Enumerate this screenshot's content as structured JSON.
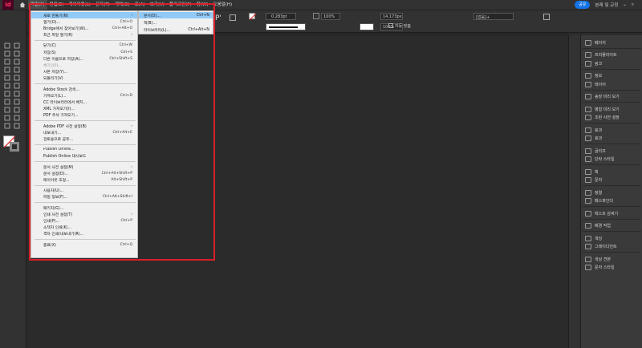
{
  "app": {
    "logo": "Id"
  },
  "menubar": {
    "items": [
      {
        "label": "파일(F)",
        "active": true
      },
      {
        "label": "편집(E)"
      },
      {
        "label": "레이아웃(L)"
      },
      {
        "label": "문자(T)"
      },
      {
        "label": "개체(O)"
      },
      {
        "label": "표(A)"
      },
      {
        "label": "보기(V)"
      },
      {
        "label": "플러그인(P)"
      },
      {
        "label": "창(W)"
      },
      {
        "label": "도움말(H)"
      }
    ],
    "share_label": "공유",
    "workspace_label": "본래 및 교정"
  },
  "controlbar": {
    "stroke_weight": "0.283pt",
    "percent_1": "100%",
    "width_value": "14.173px",
    "percent_2": "100%",
    "auto_fit_label": "자동 맞춤",
    "style_select": "[없음]+"
  },
  "file_menu": {
    "items": [
      {
        "label": "새로 만들기(N)",
        "shortcut": "",
        "arrow": true,
        "highlight": true
      },
      {
        "label": "열기(O)...",
        "shortcut": "Ctrl+O"
      },
      {
        "label": "Bridge에서 찾아보기(W)...",
        "shortcut": "Ctrl+Alt+O"
      },
      {
        "label": "최근 파일 열기(R)",
        "shortcut": "",
        "arrow": true
      },
      {
        "sep": true
      },
      {
        "label": "닫기(C)",
        "shortcut": "Ctrl+W"
      },
      {
        "label": "저장(S)",
        "shortcut": "Ctrl+S"
      },
      {
        "label": "다른 이름으로 저장(A)...",
        "shortcut": "Ctrl+Shift+S"
      },
      {
        "label": "체크인(I)...",
        "disabled": true
      },
      {
        "label": "사본 저장(Y)..."
      },
      {
        "label": "되돌리기(V)"
      },
      {
        "sep": true
      },
      {
        "label": "Adobe Stock 검색..."
      },
      {
        "label": "가져오기(L)...",
        "shortcut": "Ctrl+D"
      },
      {
        "label": "CC 라이브러리에서 배치..."
      },
      {
        "label": "XML 가져오기(I)..."
      },
      {
        "label": "PDF 주석 가져오기..."
      },
      {
        "sep": true
      },
      {
        "label": "Adobe PDF 사전 설정(B)",
        "arrow": true
      },
      {
        "label": "내보내기...",
        "shortcut": "Ctrl+Alt+E"
      },
      {
        "label": "검토용으로 공유..."
      },
      {
        "sep": true
      },
      {
        "label": "Publish Online..."
      },
      {
        "label": "Publish Online 대시보드"
      },
      {
        "sep": true
      },
      {
        "label": "문서 사전 설정(M)",
        "arrow": true
      },
      {
        "label": "문서 설정(D)...",
        "shortcut": "Ctrl+Alt+Shift+P"
      },
      {
        "label": "레이아웃 조정...",
        "shortcut": "Alt+Shift+P"
      },
      {
        "sep": true
      },
      {
        "label": "사용자(U)..."
      },
      {
        "label": "파일 정보(F)...",
        "shortcut": "Ctrl+Alt+Shift+I"
      },
      {
        "sep": true
      },
      {
        "label": "패키지(G)..."
      },
      {
        "label": "인쇄 사전 설정(T)",
        "arrow": true
      },
      {
        "label": "인쇄(P)...",
        "shortcut": "Ctrl+P"
      },
      {
        "label": "소책자 인쇄(K)..."
      },
      {
        "label": "격자 인쇄/내보내기(R)..."
      },
      {
        "sep": true
      },
      {
        "label": "종료(X)",
        "shortcut": "Ctrl+Q"
      }
    ]
  },
  "new_submenu": {
    "items": [
      {
        "label": "문서(D)...",
        "shortcut": "Ctrl+N",
        "highlight": true
      },
      {
        "label": "책(B)..."
      },
      {
        "label": "라이브러리(L)...",
        "shortcut": "Ctrl+Alt+N"
      }
    ]
  },
  "right_panel": {
    "items": [
      {
        "label": "페이지",
        "icon": "pages-icon"
      },
      {
        "sep": true
      },
      {
        "label": "프리플라이트",
        "icon": "preflight-icon"
      },
      {
        "label": "링크",
        "icon": "links-icon"
      },
      {
        "sep": true
      },
      {
        "label": "정보",
        "icon": "info-icon"
      },
      {
        "label": "레이어",
        "icon": "layers-icon"
      },
      {
        "sep": true
      },
      {
        "label": "송장 미리 보기",
        "icon": "invoice-preview-icon"
      },
      {
        "sep": true
      },
      {
        "label": "병합 미리 보기",
        "icon": "merge-preview-icon"
      },
      {
        "label": "조판 사전 설정",
        "icon": "typesetting-icon"
      },
      {
        "sep": true
      },
      {
        "label": "효과",
        "icon": "fx-icon"
      },
      {
        "label": "효과",
        "icon": "effects-icon"
      },
      {
        "sep": true
      },
      {
        "label": "글리프",
        "icon": "glyphs-icon"
      },
      {
        "label": "단락 스타일",
        "icon": "paragraph-style-icon"
      },
      {
        "sep": true
      },
      {
        "label": "획",
        "icon": "stroke-icon"
      },
      {
        "label": "문자",
        "icon": "character-icon"
      },
      {
        "sep": true
      },
      {
        "label": "정렬",
        "icon": "align-icon"
      },
      {
        "label": "패스파인더",
        "icon": "pathfinder-icon"
      },
      {
        "sep": true
      },
      {
        "label": "텍스트 감싸기",
        "icon": "text-wrap-icon"
      },
      {
        "sep": true
      },
      {
        "label": "배경 작업",
        "icon": "background-tasks-icon"
      },
      {
        "sep": true
      },
      {
        "label": "색상",
        "icon": "color-icon"
      },
      {
        "label": "그레이디언트",
        "icon": "gradient-icon"
      },
      {
        "sep": true
      },
      {
        "label": "색상 견본",
        "icon": "swatches-icon"
      },
      {
        "label": "문자 스타일",
        "icon": "character-style-icon"
      }
    ]
  },
  "colors": {
    "accent_blue": "#1473e6",
    "highlight": "#91c9f7",
    "annotation_red": "#d8202a",
    "app_logo_bg": "#49021f"
  }
}
